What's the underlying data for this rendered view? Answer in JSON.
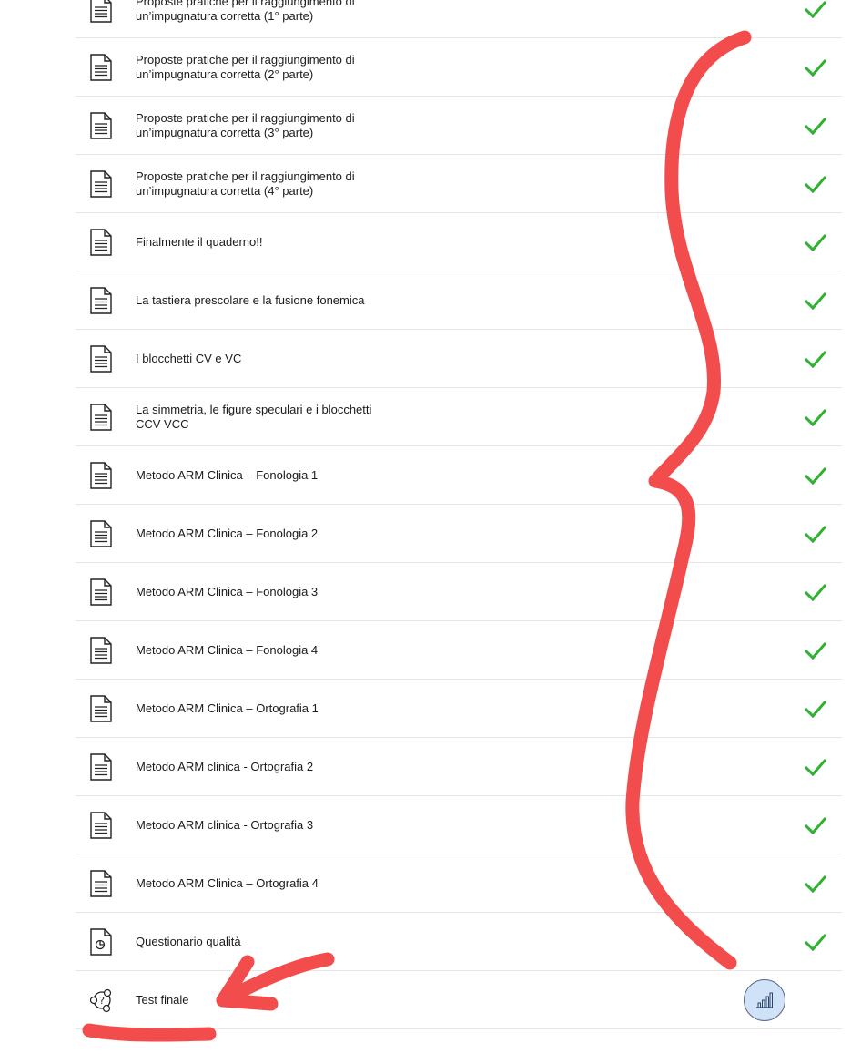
{
  "lessons": [
    {
      "icon": "document-icon",
      "title": "Proposte pratiche per il raggiungimento di un’impugnatura corretta (1° parte)",
      "status": "completed"
    },
    {
      "icon": "document-icon",
      "title": "Proposte pratiche per il raggiungimento di un’impugnatura corretta (2° parte)",
      "status": "completed"
    },
    {
      "icon": "document-icon",
      "title": "Proposte pratiche per il raggiungimento di un’impugnatura corretta (3° parte)",
      "status": "completed"
    },
    {
      "icon": "document-icon",
      "title": "Proposte pratiche per il raggiungimento di un’impugnatura corretta (4° parte)",
      "status": "completed"
    },
    {
      "icon": "document-icon",
      "title": "Finalmente il quaderno!!",
      "status": "completed"
    },
    {
      "icon": "document-icon",
      "title": "La tastiera prescolare e la fusione fonemica",
      "status": "completed"
    },
    {
      "icon": "document-icon",
      "title": "I blocchetti CV e VC",
      "status": "completed"
    },
    {
      "icon": "document-icon",
      "title": "La simmetria, le figure speculari e i blocchetti CCV-VCC",
      "status": "completed"
    },
    {
      "icon": "document-icon",
      "title": "Metodo ARM Clinica – Fonologia 1",
      "status": "completed"
    },
    {
      "icon": "document-icon",
      "title": "Metodo ARM Clinica – Fonologia 2",
      "status": "completed"
    },
    {
      "icon": "document-icon",
      "title": "Metodo ARM Clinica – Fonologia 3",
      "status": "completed"
    },
    {
      "icon": "document-icon",
      "title": "Metodo ARM Clinica – Fonologia 4",
      "status": "completed"
    },
    {
      "icon": "document-icon",
      "title": "Metodo ARM Clinica – Ortografia 1",
      "status": "completed"
    },
    {
      "icon": "document-icon",
      "title": "Metodo ARM clinica - Ortografia 2",
      "status": "completed"
    },
    {
      "icon": "document-icon",
      "title": "Metodo ARM clinica - Ortografia 3",
      "status": "completed"
    },
    {
      "icon": "document-icon",
      "title": "Metodo ARM Clinica – Ortografia 4",
      "status": "completed"
    },
    {
      "icon": "survey-document-icon",
      "title": "Questionario qualità",
      "status": "completed"
    },
    {
      "icon": "quiz-icon",
      "title": "Test finale",
      "status": "pending"
    }
  ],
  "colors": {
    "check": "#2eb135",
    "annotation": "#f24c4c",
    "stats_button_bg": "#cfe2f8"
  },
  "stats_button": {
    "icon": "bar-chart-icon"
  }
}
